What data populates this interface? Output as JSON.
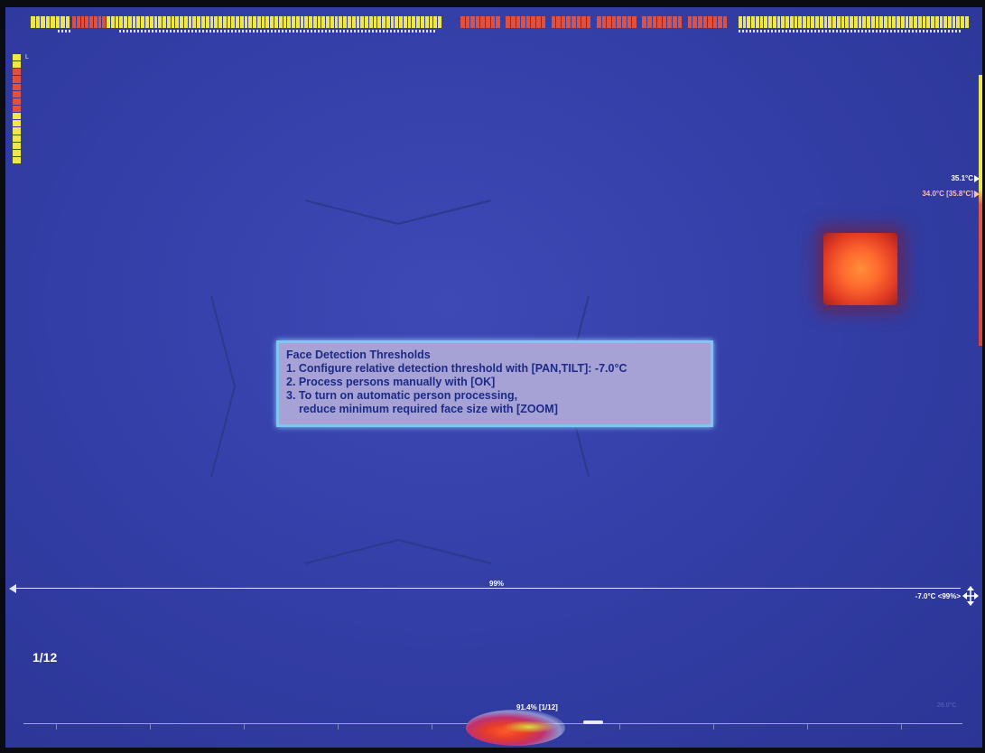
{
  "colors": {
    "background_blue": "#343fa8",
    "meter_yellow": "#eee64a",
    "meter_red": "#e0503e",
    "dialog_fill": "#a6a2d6",
    "dialog_border": "#7fc7f0",
    "dialog_text": "#1d2a86"
  },
  "top_meters": {
    "left_group_colors": [
      "#eee64a",
      "#e0503e",
      "#eee64a"
    ],
    "middle_groups": 6,
    "right_group_color": "#eee64a"
  },
  "left_meter": {
    "label": "L",
    "cells": [
      "#eee64a",
      "#eee64a",
      "#e0503e",
      "#e0503e",
      "#e0503e",
      "#e0503e",
      "#e0503e",
      "#e0503e",
      "#eee64a",
      "#eee64a",
      "#eee64a",
      "#eee64a",
      "#eee64a",
      "#eee64a",
      "#eee64a"
    ]
  },
  "temperatures": {
    "max_label": "35.1°C",
    "face_label": "34.0°C [35.8°C]"
  },
  "dialog": {
    "title": "Face Detection Thresholds",
    "lines": [
      "1. Configure relative detection threshold with [PAN,TILT]: -7.0°C",
      "2. Process persons manually with [OK]",
      "3. To turn on automatic person processing,",
      "reduce minimum required face size with [ZOOM]"
    ]
  },
  "threshold": {
    "percent_label": "99%",
    "right_label": "-7.0°C <99%>"
  },
  "page_counter": "1/12",
  "histogram": {
    "label": "91.4% [1/12]",
    "ghost_label": "26.0°C"
  },
  "icons": {
    "move": "four-way-arrow-icon",
    "left_arrow": "arrow-left-icon",
    "temp_marker": "triangle-right-icon"
  }
}
